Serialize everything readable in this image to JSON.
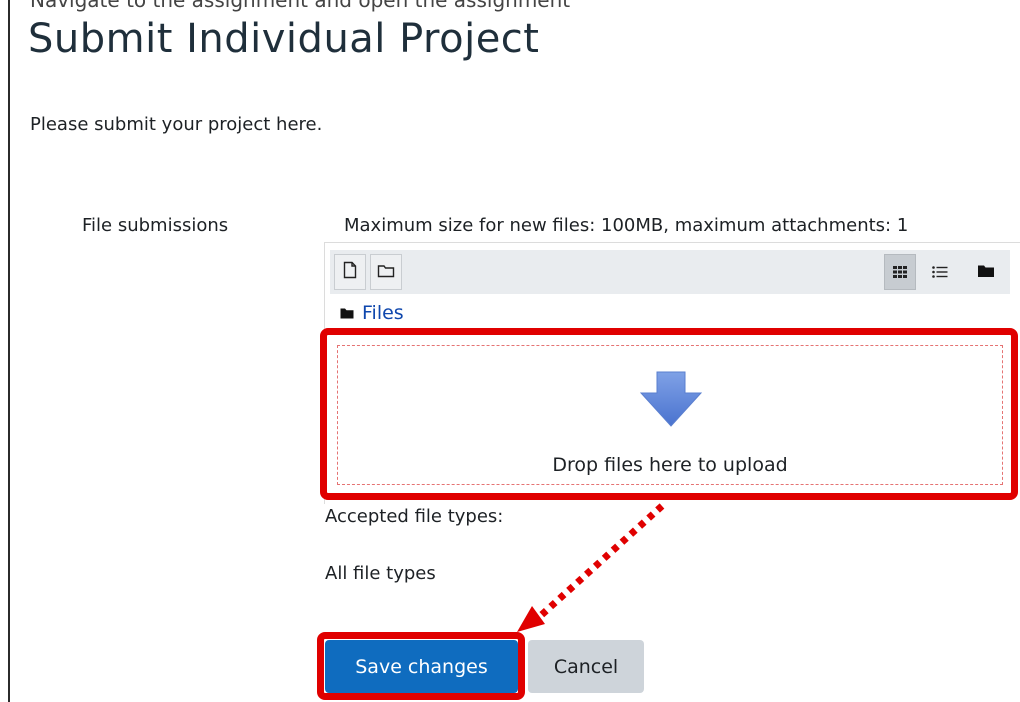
{
  "header": {
    "cut_text": "Navigate to the assignment and open the assignment",
    "title": "Submit Individual Project"
  },
  "intro": "Please submit your project here.",
  "file_submissions": {
    "label": "File submissions",
    "limits": "Maximum size for new files: 100MB, maximum attachments: 1",
    "toolbar": {
      "left": [
        "new-file-icon",
        "new-folder-icon"
      ],
      "right": [
        "grid-view-icon",
        "list-view-icon",
        "folder-view-icon"
      ]
    },
    "folder_label": "Files",
    "drop_text": "Drop files here to upload",
    "accepted_label": "Accepted file types:",
    "accepted_value": "All file types"
  },
  "actions": {
    "save": "Save changes",
    "cancel": "Cancel"
  },
  "colors": {
    "highlight": "#e00000",
    "primary": "#0f6cbf",
    "secondary": "#ced4da",
    "link": "#0f47ad"
  }
}
